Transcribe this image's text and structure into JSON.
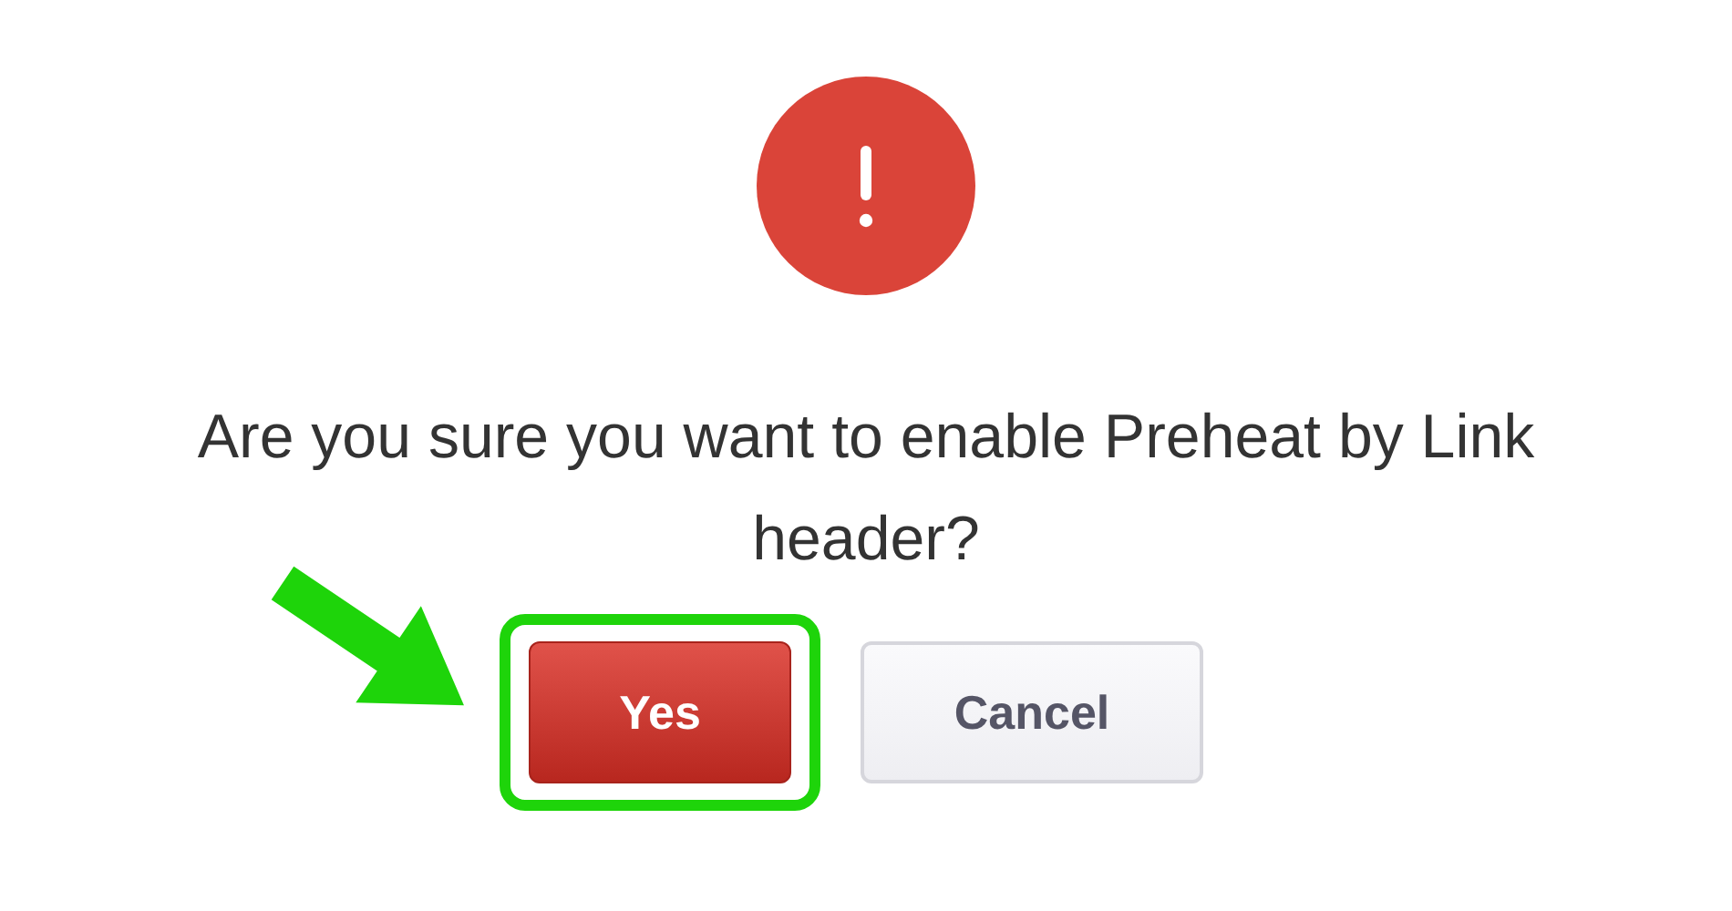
{
  "dialog": {
    "message": "Are you sure you want to enable Preheat by Link header?",
    "buttons": [
      {
        "label": "Yes",
        "kind": "primary",
        "highlighted": true
      },
      {
        "label": "Cancel",
        "kind": "secondary",
        "highlighted": false
      }
    ]
  }
}
